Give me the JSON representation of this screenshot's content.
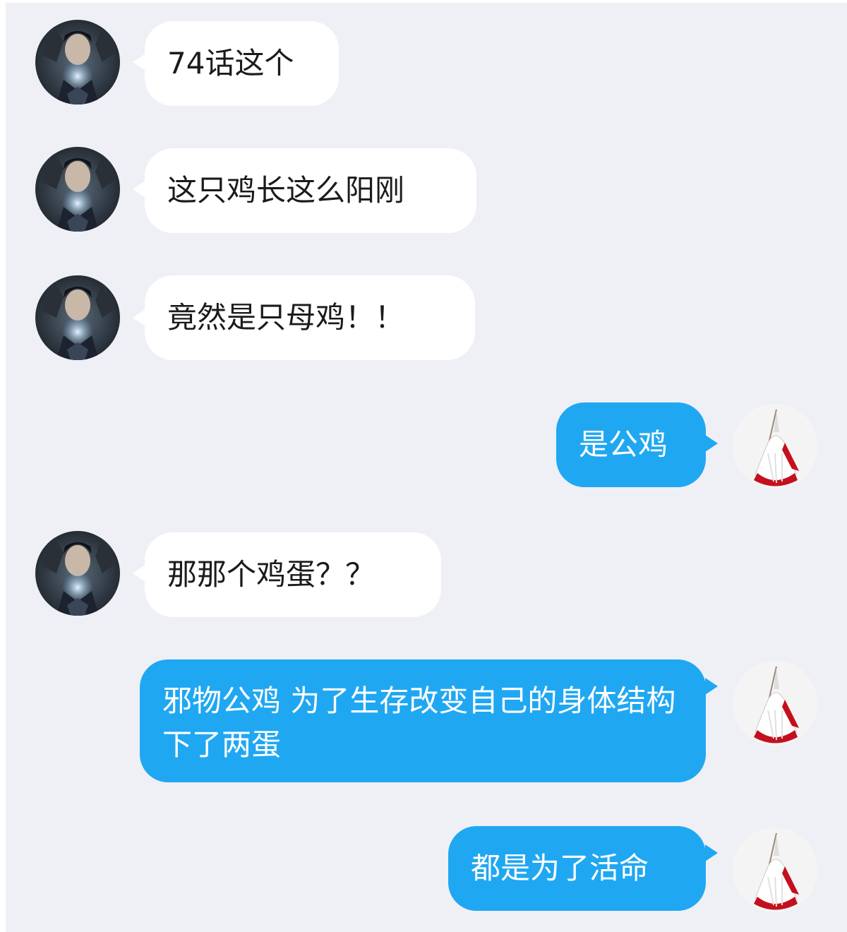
{
  "colors": {
    "background": "#eef0f5",
    "incoming_bubble": "#ffffff",
    "outgoing_bubble": "#20a7f2",
    "incoming_text": "#1b1b1b",
    "outgoing_text": "#ffffff"
  },
  "participants": {
    "left": {
      "avatar_icon": "dark-haired-character-avatar-icon"
    },
    "right": {
      "avatar_icon": "white-red-figure-avatar-icon"
    }
  },
  "messages": [
    {
      "side": "left",
      "text": "74话这个"
    },
    {
      "side": "left",
      "text": "这只鸡长这么阳刚"
    },
    {
      "side": "left",
      "text": "竟然是只母鸡！！"
    },
    {
      "side": "right",
      "text": "是公鸡"
    },
    {
      "side": "left",
      "text": "那那个鸡蛋？？"
    },
    {
      "side": "right",
      "text": "邪物公鸡  为了生存改变自己的身体结构下了两蛋"
    },
    {
      "side": "right",
      "text": "都是为了活命"
    }
  ]
}
